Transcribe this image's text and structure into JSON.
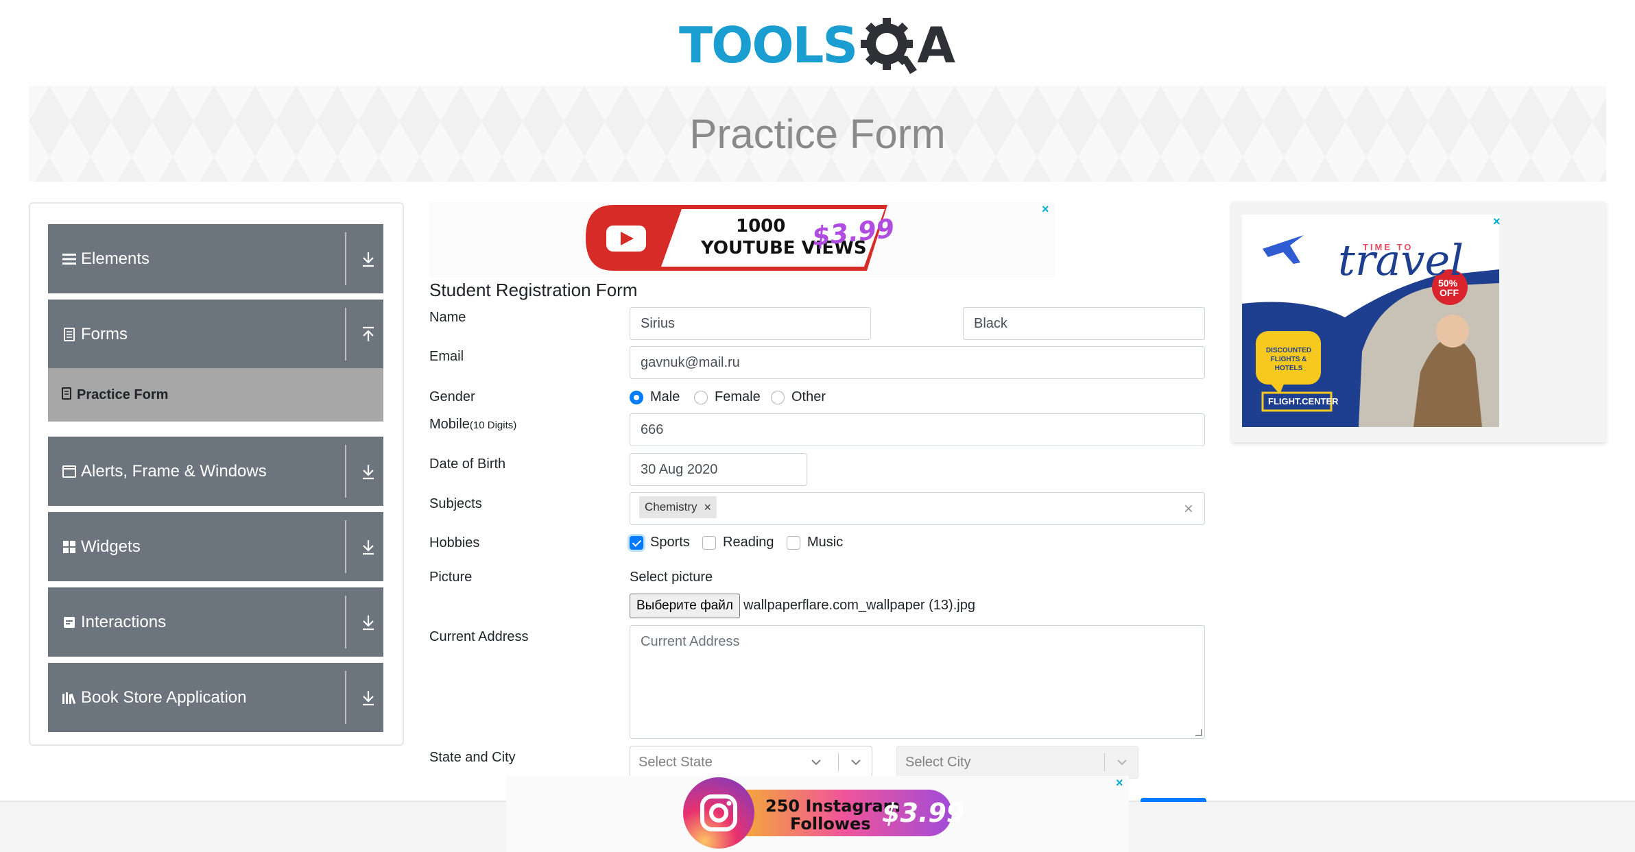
{
  "brand": {
    "name_part1": "TOOLS",
    "name_part2": "A"
  },
  "header": {
    "title": "Practice Form"
  },
  "sidebar": {
    "groups": [
      {
        "label": "Elements",
        "icon": "hamburger-icon"
      },
      {
        "label": "Forms",
        "icon": "form-icon"
      },
      {
        "label": "Alerts, Frame & Windows",
        "icon": "window-icon"
      },
      {
        "label": "Widgets",
        "icon": "grid-icon"
      },
      {
        "label": "Interactions",
        "icon": "interactions-icon"
      },
      {
        "label": "Book Store Application",
        "icon": "books-icon"
      }
    ],
    "active_item": "Practice Form"
  },
  "ads": {
    "top": {
      "line1": "1000",
      "line2": "YOUTUBE VIEWS",
      "price": "$3.99",
      "close": "×"
    },
    "right": {
      "top_small": "TIME TO",
      "headline": "travel",
      "badge1": "50%",
      "badge2": "OFF",
      "bubble": "DISCOUNTED FLIGHTS & HOTELS",
      "brand": "FLIGHT.CENTER",
      "close": "×"
    },
    "bottom": {
      "line1": "250 Instagram",
      "line2": "Followes",
      "price": "$3.99",
      "close": "×"
    }
  },
  "form": {
    "title": "Student Registration Form",
    "labels": {
      "name": "Name",
      "email": "Email",
      "gender": "Gender",
      "mobile": "Mobile",
      "mobile_hint": "(10 Digits)",
      "dob": "Date of Birth",
      "subjects": "Subjects",
      "hobbies": "Hobbies",
      "picture": "Picture",
      "address": "Current Address",
      "state_city": "State and City"
    },
    "first_name": "Sirius",
    "last_name": "Black",
    "email": "gavnuk@mail.ru",
    "gender_options": [
      "Male",
      "Female",
      "Other"
    ],
    "gender_selected": "Male",
    "mobile": "666",
    "dob": "30 Aug 2020",
    "subject_chip": "Chemistry",
    "subject_chip_remove": "×",
    "subjects_clear": "×",
    "hobbies": [
      {
        "label": "Sports",
        "checked": true
      },
      {
        "label": "Reading",
        "checked": false
      },
      {
        "label": "Music",
        "checked": false
      }
    ],
    "picture_prompt": "Select picture",
    "file_button": "Выберите файл",
    "file_name": "wallpaperflare.com_wallpaper (13).jpg",
    "address_placeholder": "Current Address",
    "state_placeholder": "Select State",
    "city_placeholder": "Select City"
  },
  "colors": {
    "accent": "#007bff",
    "sidebar": "#6c757d",
    "active": "#a7a7a7",
    "logo_blue": "#1a9ed1",
    "logo_dark": "#2f3136"
  }
}
